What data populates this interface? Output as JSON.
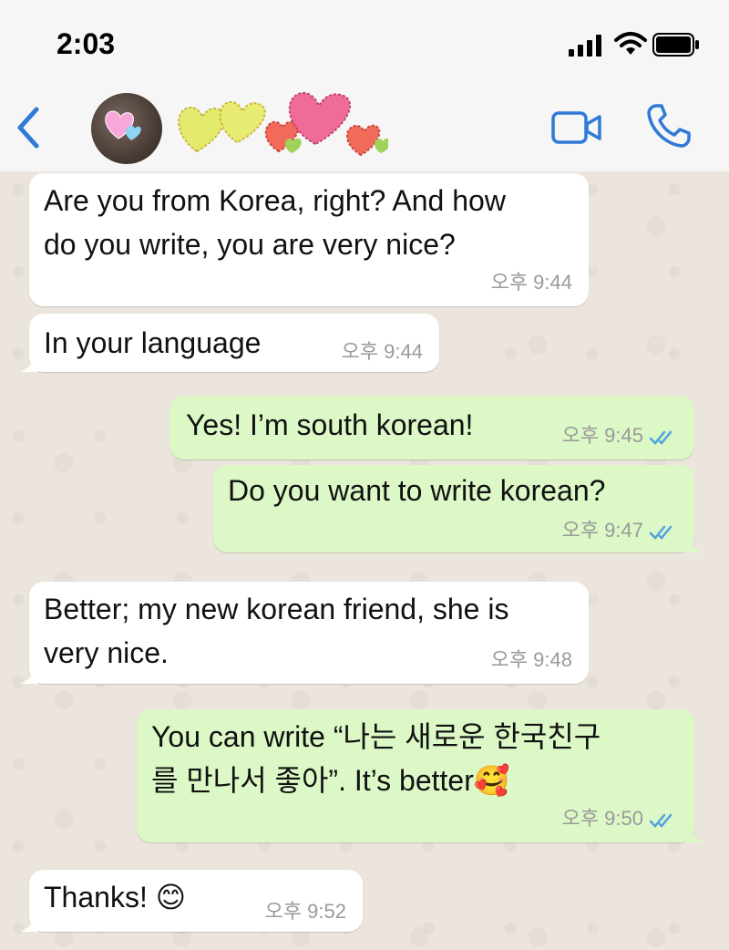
{
  "status_bar": {
    "time": "2:03"
  },
  "header": {
    "back_icon": "chevron-left-icon",
    "contact_avatar": "avatar",
    "video_icon": "video-camera-icon",
    "call_icon": "phone-icon"
  },
  "colors": {
    "accent": "#2f7ad6",
    "outgoing_bubble": "#dcf8c6",
    "incoming_bubble": "#ffffff",
    "read_ticks": "#4fa3e0"
  },
  "messages": [
    {
      "direction": "in",
      "text": "Are you from Korea, right? And how\ndo you write, you are very nice?",
      "time": "오후 9:44"
    },
    {
      "direction": "in",
      "text": "In your language",
      "time": "오후 9:44"
    },
    {
      "direction": "out",
      "text": "Yes! I’m south korean!",
      "time": "오후 9:45",
      "status": "read"
    },
    {
      "direction": "out",
      "text": "Do you want to write korean?",
      "time": "오후 9:47",
      "status": "read"
    },
    {
      "direction": "in",
      "text": "Better; my new korean friend, she is\nvery nice.",
      "time": "오후 9:48"
    },
    {
      "direction": "out",
      "text": "You can write “나는 새로운 한국친구\n를 만나서 좋아”. It’s better🥰",
      "time": "오후 9:50",
      "status": "read"
    },
    {
      "direction": "in",
      "text": "Thanks! 😊",
      "time": "오후 9:52"
    }
  ]
}
